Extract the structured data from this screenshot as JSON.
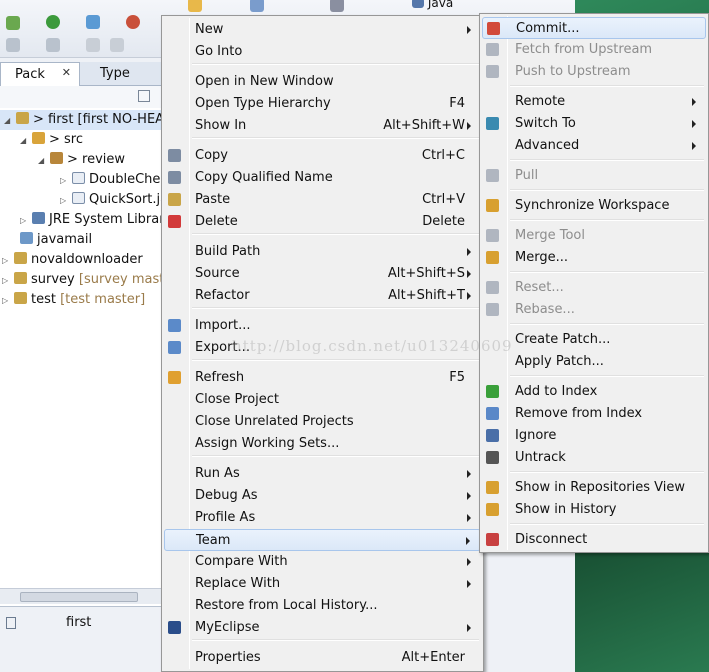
{
  "toolbar": {
    "java_perspective_label": "Java"
  },
  "tabs": [
    {
      "label": "Pack"
    },
    {
      "label": "Type"
    }
  ],
  "tree": [
    {
      "label": "> first [first NO-HEAD]",
      "muted": ""
    },
    {
      "label": "> src",
      "muted": ""
    },
    {
      "label": "> review",
      "muted": ""
    },
    {
      "label": "DoubleChec",
      "muted": ""
    },
    {
      "label": "QuickSort.ja",
      "muted": ""
    },
    {
      "label": "JRE System Library",
      "muted": ""
    },
    {
      "label": "javamail",
      "muted": ""
    },
    {
      "label": "novaldownloader",
      "muted": ""
    },
    {
      "label": "survey ",
      "muted": "[survey master]"
    },
    {
      "label": "test ",
      "muted": "[test master]"
    }
  ],
  "status": {
    "selection": "first"
  },
  "watermark": "http://blog.csdn.net/u013240609",
  "context_menu": {
    "items": [
      {
        "label": "New",
        "shortcut": "",
        "submenu": true
      },
      {
        "label": "Go Into",
        "shortcut": "",
        "submenu": false
      },
      {
        "label": "Open in New Window",
        "shortcut": "",
        "submenu": false
      },
      {
        "label": "Open Type Hierarchy",
        "shortcut": "F4",
        "submenu": false
      },
      {
        "label": "Show In",
        "shortcut": "Alt+Shift+W",
        "submenu": true
      },
      {
        "label": "Copy",
        "shortcut": "Ctrl+C",
        "submenu": false
      },
      {
        "label": "Copy Qualified Name",
        "shortcut": "",
        "submenu": false
      },
      {
        "label": "Paste",
        "shortcut": "Ctrl+V",
        "submenu": false
      },
      {
        "label": "Delete",
        "shortcut": "Delete",
        "submenu": false
      },
      {
        "label": "Build Path",
        "shortcut": "",
        "submenu": true
      },
      {
        "label": "Source",
        "shortcut": "Alt+Shift+S",
        "submenu": true
      },
      {
        "label": "Refactor",
        "shortcut": "Alt+Shift+T",
        "submenu": true
      },
      {
        "label": "Import...",
        "shortcut": "",
        "submenu": false
      },
      {
        "label": "Export...",
        "shortcut": "",
        "submenu": false
      },
      {
        "label": "Refresh",
        "shortcut": "F5",
        "submenu": false
      },
      {
        "label": "Close Project",
        "shortcut": "",
        "submenu": false
      },
      {
        "label": "Close Unrelated Projects",
        "shortcut": "",
        "submenu": false
      },
      {
        "label": "Assign Working Sets...",
        "shortcut": "",
        "submenu": false
      },
      {
        "label": "Run As",
        "shortcut": "",
        "submenu": true
      },
      {
        "label": "Debug As",
        "shortcut": "",
        "submenu": true
      },
      {
        "label": "Profile As",
        "shortcut": "",
        "submenu": true
      },
      {
        "label": "Team",
        "shortcut": "",
        "submenu": true
      },
      {
        "label": "Compare With",
        "shortcut": "",
        "submenu": true
      },
      {
        "label": "Replace With",
        "shortcut": "",
        "submenu": true
      },
      {
        "label": "Restore from Local History...",
        "shortcut": "",
        "submenu": false
      },
      {
        "label": "MyEclipse",
        "shortcut": "",
        "submenu": true
      },
      {
        "label": "Properties",
        "shortcut": "Alt+Enter",
        "submenu": false
      }
    ]
  },
  "team_menu": {
    "items": [
      {
        "label": "Commit...",
        "submenu": false,
        "disabled": false
      },
      {
        "label": "Fetch from Upstream",
        "submenu": false,
        "disabled": true
      },
      {
        "label": "Push to Upstream",
        "submenu": false,
        "disabled": true
      },
      {
        "label": "Remote",
        "submenu": true,
        "disabled": false
      },
      {
        "label": "Switch To",
        "submenu": true,
        "disabled": false
      },
      {
        "label": "Advanced",
        "submenu": true,
        "disabled": false
      },
      {
        "label": "Pull",
        "submenu": false,
        "disabled": true
      },
      {
        "label": "Synchronize Workspace",
        "submenu": false,
        "disabled": false
      },
      {
        "label": "Merge Tool",
        "submenu": false,
        "disabled": true
      },
      {
        "label": "Merge...",
        "submenu": false,
        "disabled": false
      },
      {
        "label": "Reset...",
        "submenu": false,
        "disabled": true
      },
      {
        "label": "Rebase...",
        "submenu": false,
        "disabled": true
      },
      {
        "label": "Create Patch...",
        "submenu": false,
        "disabled": false
      },
      {
        "label": "Apply Patch...",
        "submenu": false,
        "disabled": false
      },
      {
        "label": "Add to Index",
        "submenu": false,
        "disabled": false
      },
      {
        "label": "Remove from Index",
        "submenu": false,
        "disabled": false
      },
      {
        "label": "Ignore",
        "submenu": false,
        "disabled": false
      },
      {
        "label": "Untrack",
        "submenu": false,
        "disabled": false
      },
      {
        "label": "Show in Repositories View",
        "submenu": false,
        "disabled": false
      },
      {
        "label": "Show in History",
        "submenu": false,
        "disabled": false
      },
      {
        "label": "Disconnect",
        "submenu": false,
        "disabled": false
      }
    ]
  }
}
